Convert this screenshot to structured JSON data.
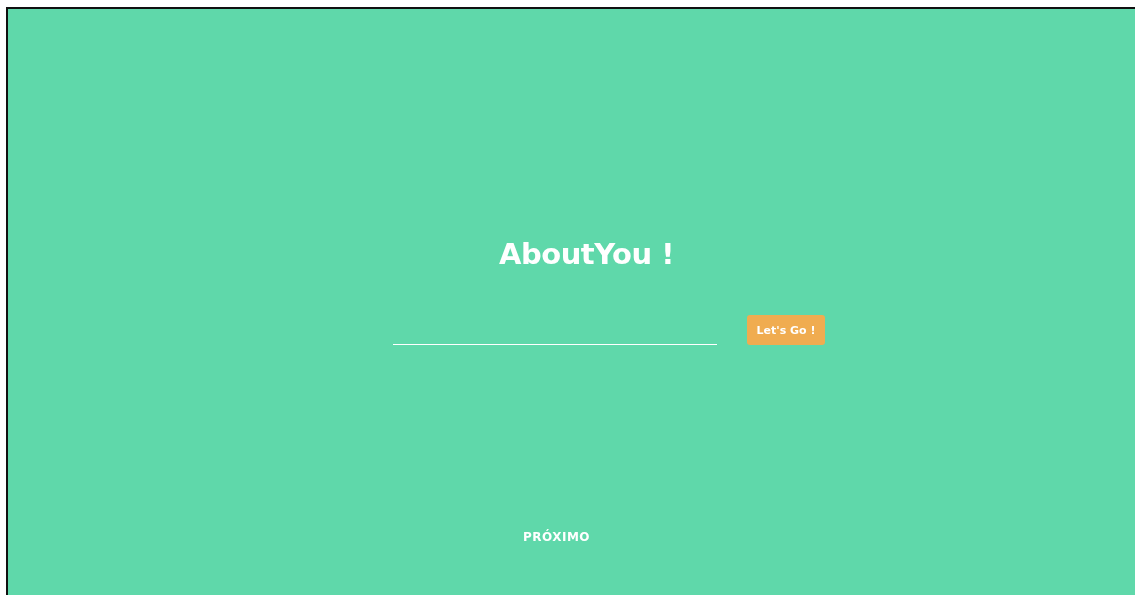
{
  "title": "AboutYou !",
  "button": {
    "label": "Let's Go !"
  },
  "next_link": {
    "label": "PRÓXIMO"
  }
}
